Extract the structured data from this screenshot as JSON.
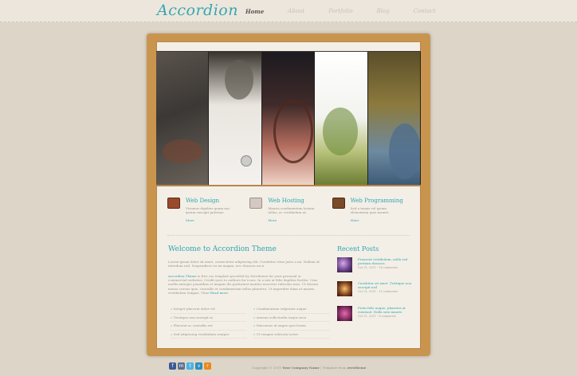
{
  "site": {
    "logo": "Accordion"
  },
  "nav": [
    {
      "label": "Home",
      "active": true
    },
    {
      "label": "About",
      "active": false
    },
    {
      "label": "Portfolio",
      "active": false
    },
    {
      "label": "Blog",
      "active": false
    },
    {
      "label": "Contact",
      "active": false
    }
  ],
  "features": [
    {
      "title": "Web Design",
      "text": "Vivamus dapibus quam nec ipsum suscipit pulvinar.",
      "more": "More",
      "icon": "monitor-icon",
      "color": "#9a4a2c"
    },
    {
      "title": "Web Hosting",
      "text": "Mauris condimentum lacinia tellus, ac vestibulum ut.",
      "more": "More",
      "icon": "server-icon",
      "color": "#b9a9a3"
    },
    {
      "title": "Web Programming",
      "text": "Sed a turpis vel ipsum elementum quis mauris.",
      "more": "More",
      "icon": "briefcase-icon",
      "color": "#7b4a28"
    }
  ],
  "welcome": {
    "title": "Welcome to Accordion Theme",
    "para1": "Lorem ipsum dolor sit amet, consectetur adipiscing elit. Curabitur vitae justo a mi. Nullam id interdum nisl. Suspendisse eu mi magna, nec rhoncus arcu.",
    "para2_link": "Accordion Theme",
    "para2": "is free css template provided by Zerotheme for your personal or commercial websites. Credit goes to authors for icons. In a nisi at felis dapibus facilisi. Cras mollis natoque penatibus et magnis dis parturient montes nascetur ridiculus mus. Ut dictum massa cursus quis, convallis et condimentum tellus pharetra. Ut imperdiet diam at mauris vestibulum tempus. Vitae",
    "para2_more": "Read more"
  },
  "list_left": [
    "Integer placerat dolor vel",
    "Tristique non suscipit in",
    "Placerat ac convallis est",
    "Sed adipiscing vestibulum semper"
  ],
  "list_right": [
    "Condimentum vulputate augue",
    "Aenean sollicitudin turpis arcu",
    "Maecenas id augue quis lorem",
    "Ut tempus vehicula tortor"
  ],
  "recent": {
    "title": "Recent Posts",
    "posts": [
      {
        "title": "Praesent vestibulum, nulla sed pretium rhoncus",
        "meta": "Oct 31, 2011 - 16 comments",
        "color": "#5e3a7a"
      },
      {
        "title": "Curabitur sit amet. Tristique non suscipit nisl",
        "meta": "Oct 31, 2011 - 12 comments",
        "color": "#7a3d1e"
      },
      {
        "title": "Proin felis augue, pharetra at euismod. Nulla sem mauris",
        "meta": "Oct 31, 2011 - 8 comments",
        "color": "#7e2b5e"
      }
    ]
  },
  "footer": {
    "copyright_prefix": "Copyright © 2011",
    "company": "Your Company Name",
    "template_prefix": "| Template from",
    "template_by": "zerotheme"
  }
}
